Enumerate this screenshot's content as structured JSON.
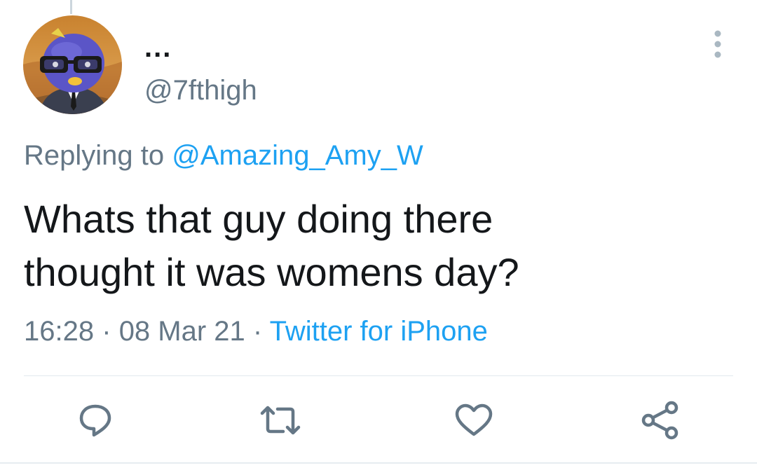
{
  "tweet": {
    "display_name": "...",
    "handle": "@7fthigh",
    "replying_prefix": "Replying to",
    "replying_to": "@Amazing_Amy_W",
    "text": "Whats that guy doing there\nthought it was womens day?",
    "time": "16:28",
    "separator": "·",
    "date": "08 Mar 21",
    "source": "Twitter for iPhone"
  },
  "icons": {
    "more": "more-vertical-icon",
    "reply": "reply-icon",
    "retweet": "retweet-icon",
    "like": "heart-icon",
    "share": "share-icon"
  },
  "colors": {
    "text": "#14171a",
    "secondary": "#657786",
    "accent": "#1da1f2",
    "divider": "#e1e8ed"
  }
}
